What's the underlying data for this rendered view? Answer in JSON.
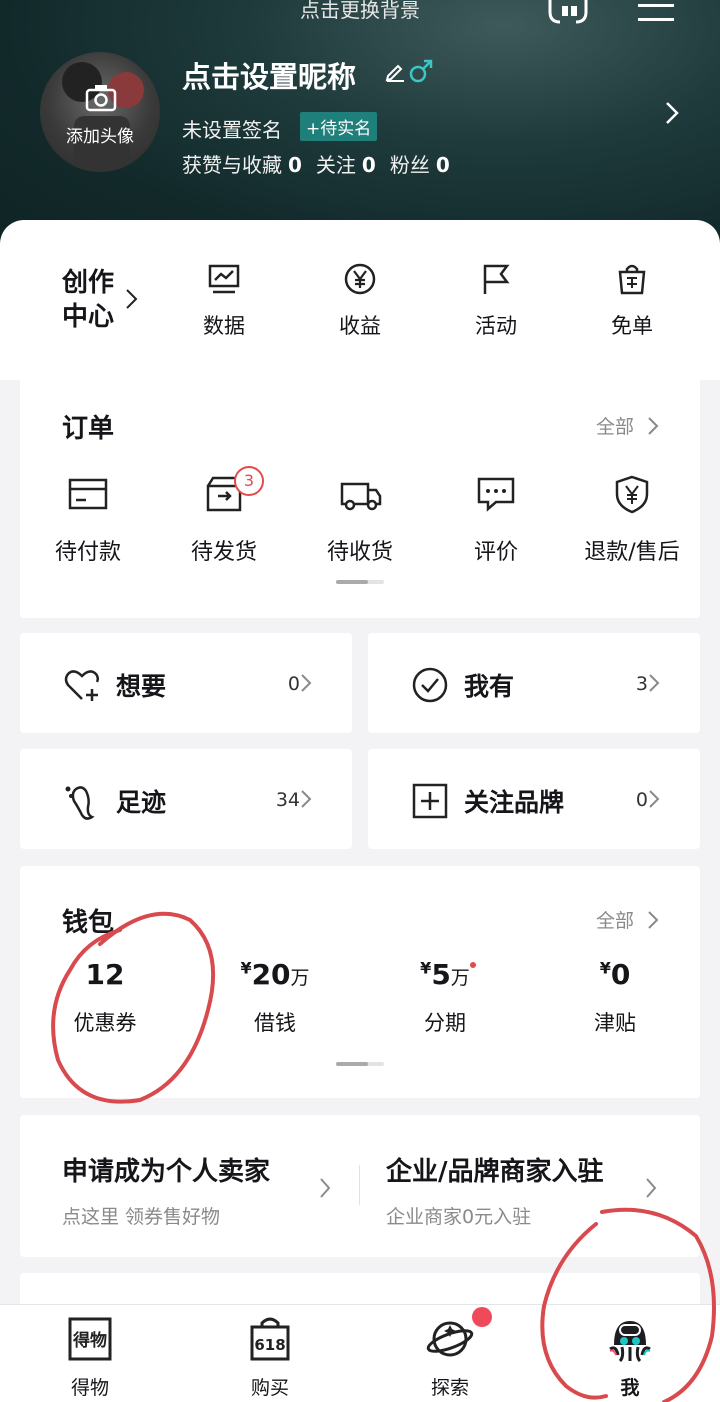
{
  "header": {
    "bg_hint": "点击更换背景",
    "avatar_label": "添加头像",
    "nickname": "点击设置昵称",
    "signature": "未设置签名",
    "realname_badge": "+待实名",
    "stats": [
      {
        "label": "获赞与收藏",
        "value": "0"
      },
      {
        "label": "关注",
        "value": "0"
      },
      {
        "label": "粉丝",
        "value": "0"
      }
    ]
  },
  "creator": {
    "title_line1": "创作",
    "title_line2": "中心",
    "items": [
      {
        "label": "数据",
        "icon": "chart-icon"
      },
      {
        "label": "收益",
        "icon": "yen-coin-icon"
      },
      {
        "label": "活动",
        "icon": "flag-icon"
      },
      {
        "label": "免单",
        "icon": "free-bag-icon"
      }
    ]
  },
  "orders": {
    "title": "订单",
    "all_label": "全部",
    "items": [
      {
        "label": "待付款",
        "icon": "wallet-card-icon"
      },
      {
        "label": "待发货",
        "icon": "box-icon",
        "badge": "3"
      },
      {
        "label": "待收货",
        "icon": "truck-icon"
      },
      {
        "label": "评价",
        "icon": "comment-icon"
      },
      {
        "label": "退款/售后",
        "icon": "shield-yen-icon"
      }
    ]
  },
  "shortcuts": {
    "want": {
      "label": "想要",
      "count": "0"
    },
    "have": {
      "label": "我有",
      "count": "3"
    },
    "footprint": {
      "label": "足迹",
      "count": "34"
    },
    "brands": {
      "label": "关注品牌",
      "count": "0"
    }
  },
  "wallet": {
    "title": "钱包",
    "all_label": "全部",
    "items": [
      {
        "value": "12",
        "unit": "",
        "prefix": "",
        "label": "优惠券"
      },
      {
        "value": "20",
        "unit": "万",
        "prefix": "¥",
        "label": "借钱"
      },
      {
        "value": "5",
        "unit": "万",
        "prefix": "¥",
        "label": "分期"
      },
      {
        "value": "0",
        "unit": "",
        "prefix": "¥",
        "label": "津贴"
      }
    ]
  },
  "seller": {
    "personal_title": "申请成为个人卖家",
    "personal_sub": "点这里 领券售好物",
    "business_title": "企业/品牌商家入驻",
    "business_sub": "企业商家0元入驻"
  },
  "nav": {
    "items": [
      {
        "label": "得物",
        "icon": "dewu-icon"
      },
      {
        "label": "购买",
        "icon": "shopping-bag-618-icon"
      },
      {
        "label": "探索",
        "icon": "planet-icon"
      },
      {
        "label": "我",
        "icon": "profile-octopus-icon"
      }
    ]
  },
  "colors": {
    "header_bg": "#12292a",
    "accent_teal": "#1f7f7a",
    "badge_red": "#e54a4a",
    "annotation_red": "#d94a4f"
  }
}
